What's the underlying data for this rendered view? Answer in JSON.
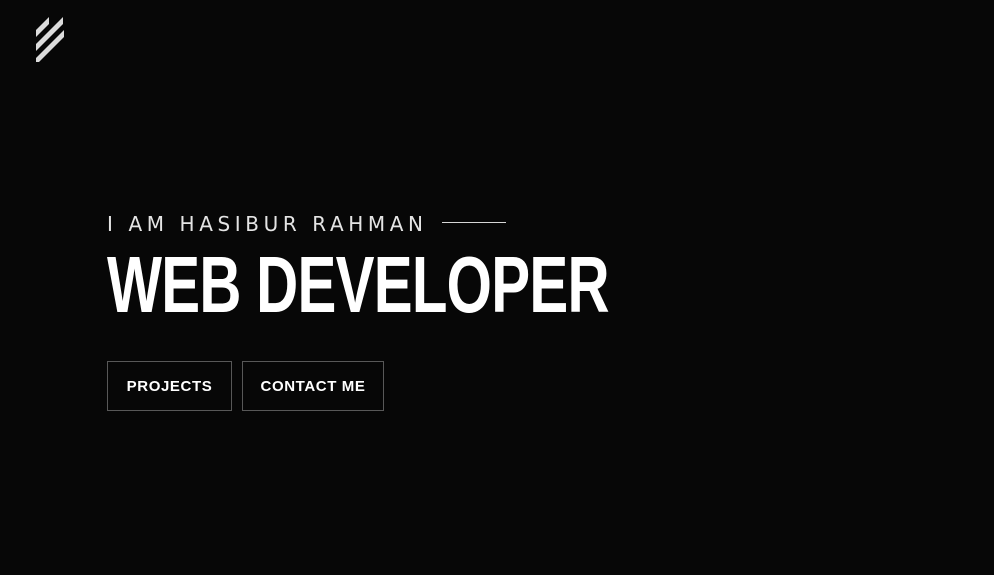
{
  "header": {
    "logo_icon": "stripes-logo-icon"
  },
  "hero": {
    "intro": "I AM HASIBUR RAHMAN",
    "title": "WEB DEVELOPER"
  },
  "actions": {
    "projects_label": "PROJECTS",
    "contact_label": "CONTACT ME"
  },
  "colors": {
    "background": "#070707",
    "text": "#ffffff",
    "button_border": "#585858"
  }
}
